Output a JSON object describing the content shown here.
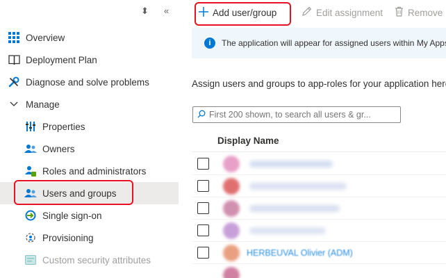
{
  "sidebar": {
    "collapse_controls": {
      "up_down": "⬍",
      "collapse": "«"
    },
    "items": [
      {
        "label": "Overview"
      },
      {
        "label": "Deployment Plan"
      },
      {
        "label": "Diagnose and solve problems"
      },
      {
        "label": "Manage"
      },
      {
        "label": "Properties"
      },
      {
        "label": "Owners"
      },
      {
        "label": "Roles and administrators"
      },
      {
        "label": "Users and groups"
      },
      {
        "label": "Single sign-on"
      },
      {
        "label": "Provisioning"
      },
      {
        "label": "Custom security attributes"
      }
    ]
  },
  "toolbar": {
    "add_label": "Add user/group",
    "edit_label": "Edit assignment",
    "remove_label": "Remove"
  },
  "info_bar": {
    "text": "The application will appear for assigned users within My Apps"
  },
  "description": "Assign users and groups to app-roles for your application here",
  "search": {
    "placeholder": "First 200 shown, to search all users & gr..."
  },
  "table": {
    "column_display_name": "Display Name",
    "rows": [
      {
        "display_name": ""
      },
      {
        "display_name": ""
      },
      {
        "display_name": ""
      },
      {
        "display_name": ""
      },
      {
        "display_name": "HERBEUVAL Olivier (ADM)"
      }
    ]
  },
  "colors": {
    "accent": "#0078d4",
    "highlight": "#e81123",
    "selected_bg": "#edebe9",
    "info_bg": "#eff6fc"
  }
}
